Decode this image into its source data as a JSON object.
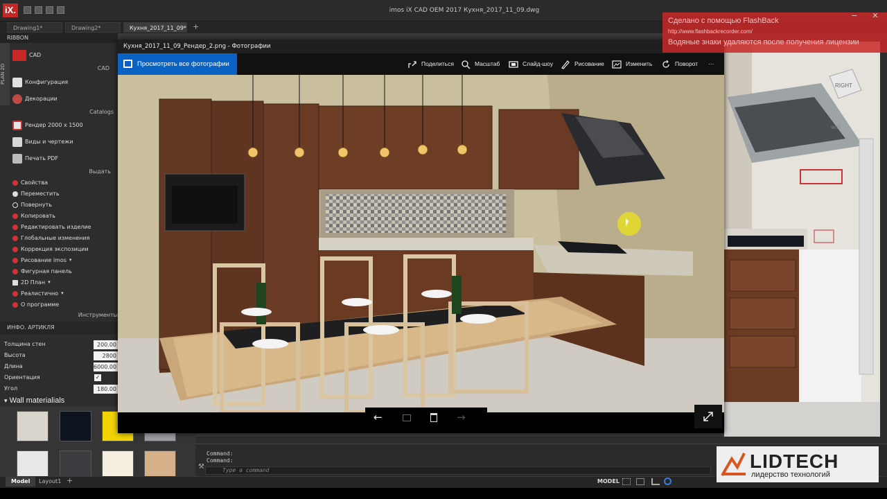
{
  "app": {
    "logo": "iX.",
    "window_title": "imos iX CAD OEM 2017   Кухня_2017_11_09.dwg"
  },
  "doc_tabs": [
    {
      "label": "Drawing1*"
    },
    {
      "label": "Drawing2*"
    },
    {
      "label": "Кухня_2017_11_09*"
    }
  ],
  "ribbon": {
    "header": "RIBBON",
    "plan_label": "PLAN 2D",
    "cad_group": {
      "item": "CAD",
      "section": "CAD"
    },
    "catalogs": {
      "items": [
        "Конфигурация",
        "Декорации"
      ],
      "section": "Catalogs"
    },
    "output": {
      "items": [
        "Рендер 2000 x 1500",
        "Виды и чертежи",
        "Печать PDF"
      ],
      "section": "Выдать"
    },
    "tools": {
      "items": [
        "Свойства",
        "Переместить",
        "Повернуть",
        "Копировать",
        "Редактировать изделие",
        "Глобальные изменения",
        "Коррекция экспозиции",
        "Рисование imos",
        "Фигурная панель",
        "2D План",
        "Реалистично",
        "О программе"
      ],
      "section": "Инструменты"
    }
  },
  "properties": {
    "header": "ИНФО. АРТИКЛЯ",
    "rows": [
      {
        "label": "Толщина стен",
        "value": "200.00"
      },
      {
        "label": "Высота",
        "value": "2800"
      },
      {
        "label": "Длина",
        "value": "6000.00"
      },
      {
        "label": "Ориентация",
        "value": "✓"
      },
      {
        "label": "Угол",
        "value": "180.00"
      }
    ],
    "materials_header": "Wall materialials",
    "swatch_colors": [
      "#d9d4cc",
      "#0d1420",
      "#f2d400",
      "#9a9da2",
      "#e8e8e8",
      "#3a3c40",
      "#f4efe0",
      "#d6b088"
    ]
  },
  "viewer": {
    "title": "Кухня_2017_11_09_Рендер_2.png - Фотографии",
    "view_all": "Просмотреть все фотографии",
    "toolbar": [
      "Поделиться",
      "Масштаб",
      "Слайд-шоу",
      "Рисование",
      "Изменить",
      "Поворот"
    ],
    "more": "···"
  },
  "command": {
    "lines": [
      "Command:",
      "Command:"
    ],
    "placeholder": "Type a command"
  },
  "status": {
    "tabs": [
      "Model",
      "Layout1"
    ],
    "mode": "MODEL"
  },
  "viewcube": {
    "face": "RIGHT",
    "wcs": "WCS"
  },
  "watermark": {
    "line1": "Сделано с помощью FlashBack",
    "line2": "http://www.flashbackrecorder.com/",
    "line3": "Водяные знаки удаляются после получения лицензии"
  },
  "brand": {
    "name": "LIDTECH",
    "tagline": "лидерство технологий"
  },
  "colors": {
    "accent_blue": "#0a63c4",
    "logo_red": "#c62828",
    "watermark_red": "#c82828"
  }
}
